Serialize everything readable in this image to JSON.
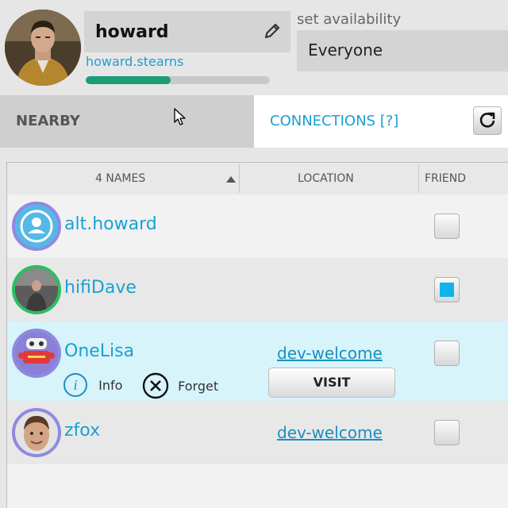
{
  "profile": {
    "display_name": "howard",
    "username": "howard.stearns",
    "progress": 0.46
  },
  "availability": {
    "label": "set availability",
    "value": "Everyone"
  },
  "tabs": {
    "nearby": "NEARBY",
    "connections": "CONNECTIONS [?]",
    "active": "connections"
  },
  "table": {
    "headers": {
      "names": "4 NAMES",
      "location": "LOCATION",
      "friend": "FRIEND"
    },
    "sort": "ascending",
    "rows": [
      {
        "name": "alt.howard",
        "location": "",
        "friend": false,
        "avatar": "default-avatar-icon"
      },
      {
        "name": "hifiDave",
        "location": "",
        "friend": true,
        "avatar": "avatar-photo"
      },
      {
        "name": "OneLisa",
        "location": "dev-welcome",
        "friend": false,
        "avatar": "robot-avatar",
        "selected": true,
        "info_label": "Info",
        "forget_label": "Forget",
        "visit_label": "VISIT"
      },
      {
        "name": "zfox",
        "location": "dev-welcome",
        "friend": false,
        "avatar": "avatar-photo"
      }
    ]
  },
  "colors": {
    "accent": "#1aa0d4",
    "progress": "#1d9c78",
    "selected_row": "#d7f4fb",
    "checkbox_fill": "#12b3ea"
  }
}
